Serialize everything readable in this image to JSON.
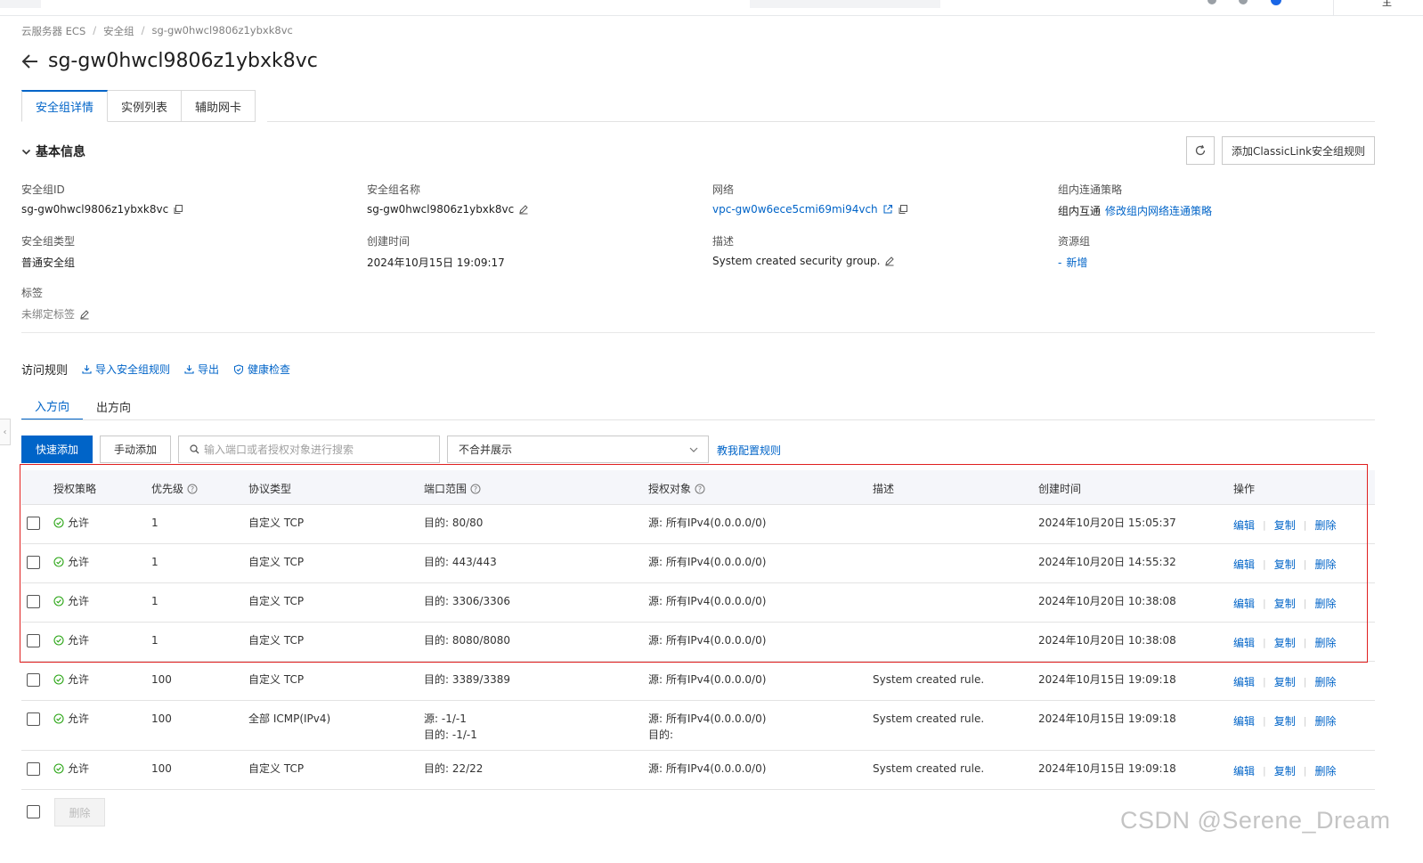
{
  "breadcrumb": {
    "item1": "云服务器 ECS",
    "item2": "安全组",
    "item3": "sg-gw0hwcl9806z1ybxk8vc"
  },
  "page_title": "sg-gw0hwcl9806z1ybxk8vc",
  "tabs": [
    {
      "label": "安全组详情",
      "active": true
    },
    {
      "label": "实例列表",
      "active": false
    },
    {
      "label": "辅助网卡",
      "active": false
    }
  ],
  "basic": {
    "section_title": "基本信息",
    "classiclink_button": "添加ClassicLink安全组规则",
    "id_label": "安全组ID",
    "id_value": "sg-gw0hwcl9806z1ybxk8vc",
    "name_label": "安全组名称",
    "name_value": "sg-gw0hwcl9806z1ybxk8vc",
    "network_label": "网络",
    "network_value": "vpc-gw0w6ece5cmi69mi94vch",
    "policy_label": "组内连通策略",
    "policy_value": "组内互通",
    "policy_link": "修改组内网络连通策略",
    "type_label": "安全组类型",
    "type_value": "普通安全组",
    "created_label": "创建时间",
    "created_value": "2024年10月15日 19:09:17",
    "desc_label": "描述",
    "desc_value": "System created security group.",
    "resgroup_label": "资源组",
    "resgroup_value": "-",
    "resgroup_link": "新增",
    "tags_label": "标签",
    "tags_value": "未绑定标签"
  },
  "rules_bar": {
    "title": "访问规则",
    "import": "导入安全组规则",
    "export": "导出",
    "health": "健康检查"
  },
  "direction_tabs": {
    "inbound": "入方向",
    "outbound": "出方向"
  },
  "toolbar": {
    "quick_add": "快速添加",
    "manual_add": "手动添加",
    "search_placeholder": "输入端口或者授权对象进行搜索",
    "select_value": "不合并展示",
    "help_link": "教我配置规则"
  },
  "table": {
    "headers": {
      "policy": "授权策略",
      "priority": "优先级",
      "protocol": "协议类型",
      "port": "端口范围",
      "auth": "授权对象",
      "desc": "描述",
      "created": "创建时间",
      "ops": "操作"
    },
    "rows": [
      {
        "policy": "允许",
        "priority": "1",
        "protocol": "自定义 TCP",
        "port1": "目的: 80/80",
        "port2": "",
        "auth1": "源: 所有IPv4(0.0.0.0/0)",
        "auth2": "",
        "desc": "",
        "created": "2024年10月20日 15:05:37"
      },
      {
        "policy": "允许",
        "priority": "1",
        "protocol": "自定义 TCP",
        "port1": "目的: 443/443",
        "port2": "",
        "auth1": "源: 所有IPv4(0.0.0.0/0)",
        "auth2": "",
        "desc": "",
        "created": "2024年10月20日 14:55:32"
      },
      {
        "policy": "允许",
        "priority": "1",
        "protocol": "自定义 TCP",
        "port1": "目的: 3306/3306",
        "port2": "",
        "auth1": "源: 所有IPv4(0.0.0.0/0)",
        "auth2": "",
        "desc": "",
        "created": "2024年10月20日 10:38:08"
      },
      {
        "policy": "允许",
        "priority": "1",
        "protocol": "自定义 TCP",
        "port1": "目的: 8080/8080",
        "port2": "",
        "auth1": "源: 所有IPv4(0.0.0.0/0)",
        "auth2": "",
        "desc": "",
        "created": "2024年10月20日 10:38:08"
      },
      {
        "policy": "允许",
        "priority": "100",
        "protocol": "自定义 TCP",
        "port1": "目的: 3389/3389",
        "port2": "",
        "auth1": "源: 所有IPv4(0.0.0.0/0)",
        "auth2": "",
        "desc": "System created rule.",
        "created": "2024年10月15日 19:09:18"
      },
      {
        "policy": "允许",
        "priority": "100",
        "protocol": "全部 ICMP(IPv4)",
        "port1": "源: -1/-1",
        "port2": "目的: -1/-1",
        "auth1": "源: 所有IPv4(0.0.0.0/0)",
        "auth2": "目的:",
        "desc": "System created rule.",
        "created": "2024年10月15日 19:09:18"
      },
      {
        "policy": "允许",
        "priority": "100",
        "protocol": "自定义 TCP",
        "port1": "目的: 22/22",
        "port2": "",
        "auth1": "源: 所有IPv4(0.0.0.0/0)",
        "auth2": "",
        "desc": "System created rule.",
        "created": "2024年10月15日 19:09:18"
      }
    ],
    "op_edit": "编辑",
    "op_copy": "复制",
    "op_delete": "删除"
  },
  "footer": {
    "delete_button": "删除"
  },
  "watermark": "CSDN @Serene_Dream",
  "colors": {
    "accent": "#0064c8",
    "success": "#2aa515",
    "highlight_border": "#e02020"
  }
}
